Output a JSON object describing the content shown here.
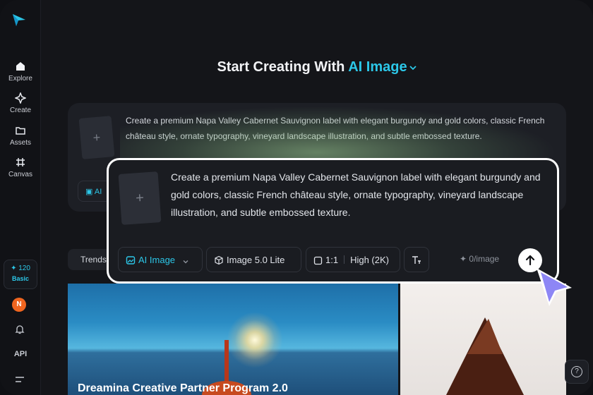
{
  "sidebar": {
    "items": [
      {
        "label": "Explore",
        "icon": "home-icon"
      },
      {
        "label": "Create",
        "icon": "sparkle-icon"
      },
      {
        "label": "Assets",
        "icon": "folder-icon"
      },
      {
        "label": "Canvas",
        "icon": "canvas-icon"
      }
    ],
    "credits": "✦ 120",
    "plan": "Basic",
    "avatar_initial": "N",
    "api_label": "API"
  },
  "headline": {
    "prefix": "Start Creating With",
    "mode": "AI Image"
  },
  "background_card": {
    "prompt": "Create a premium Napa Valley Cabernet Sauvignon label with elegant burgundy and gold colors, classic French château style, ornate typography, vineyard landscape illustration, and subtle embossed texture.",
    "chip_label": "AI"
  },
  "prompt_card": {
    "prompt": "Create a premium Napa Valley Cabernet Sauvignon label with elegant burgundy and gold colors, classic French château style, ornate typography, vineyard landscape illustration, and subtle embossed texture.",
    "mode_label": "AI Image",
    "model_label": "Image 5.0 Lite",
    "aspect_ratio": "1:1",
    "quality": "High (2K)",
    "cost": "0/image"
  },
  "trends_label": "Trends",
  "gallery": {
    "left_title": "Dreamina Creative Partner Program 2.0"
  },
  "colors": {
    "accent": "#2cc7e8",
    "background": "#141519",
    "card": "#1a1c21"
  }
}
